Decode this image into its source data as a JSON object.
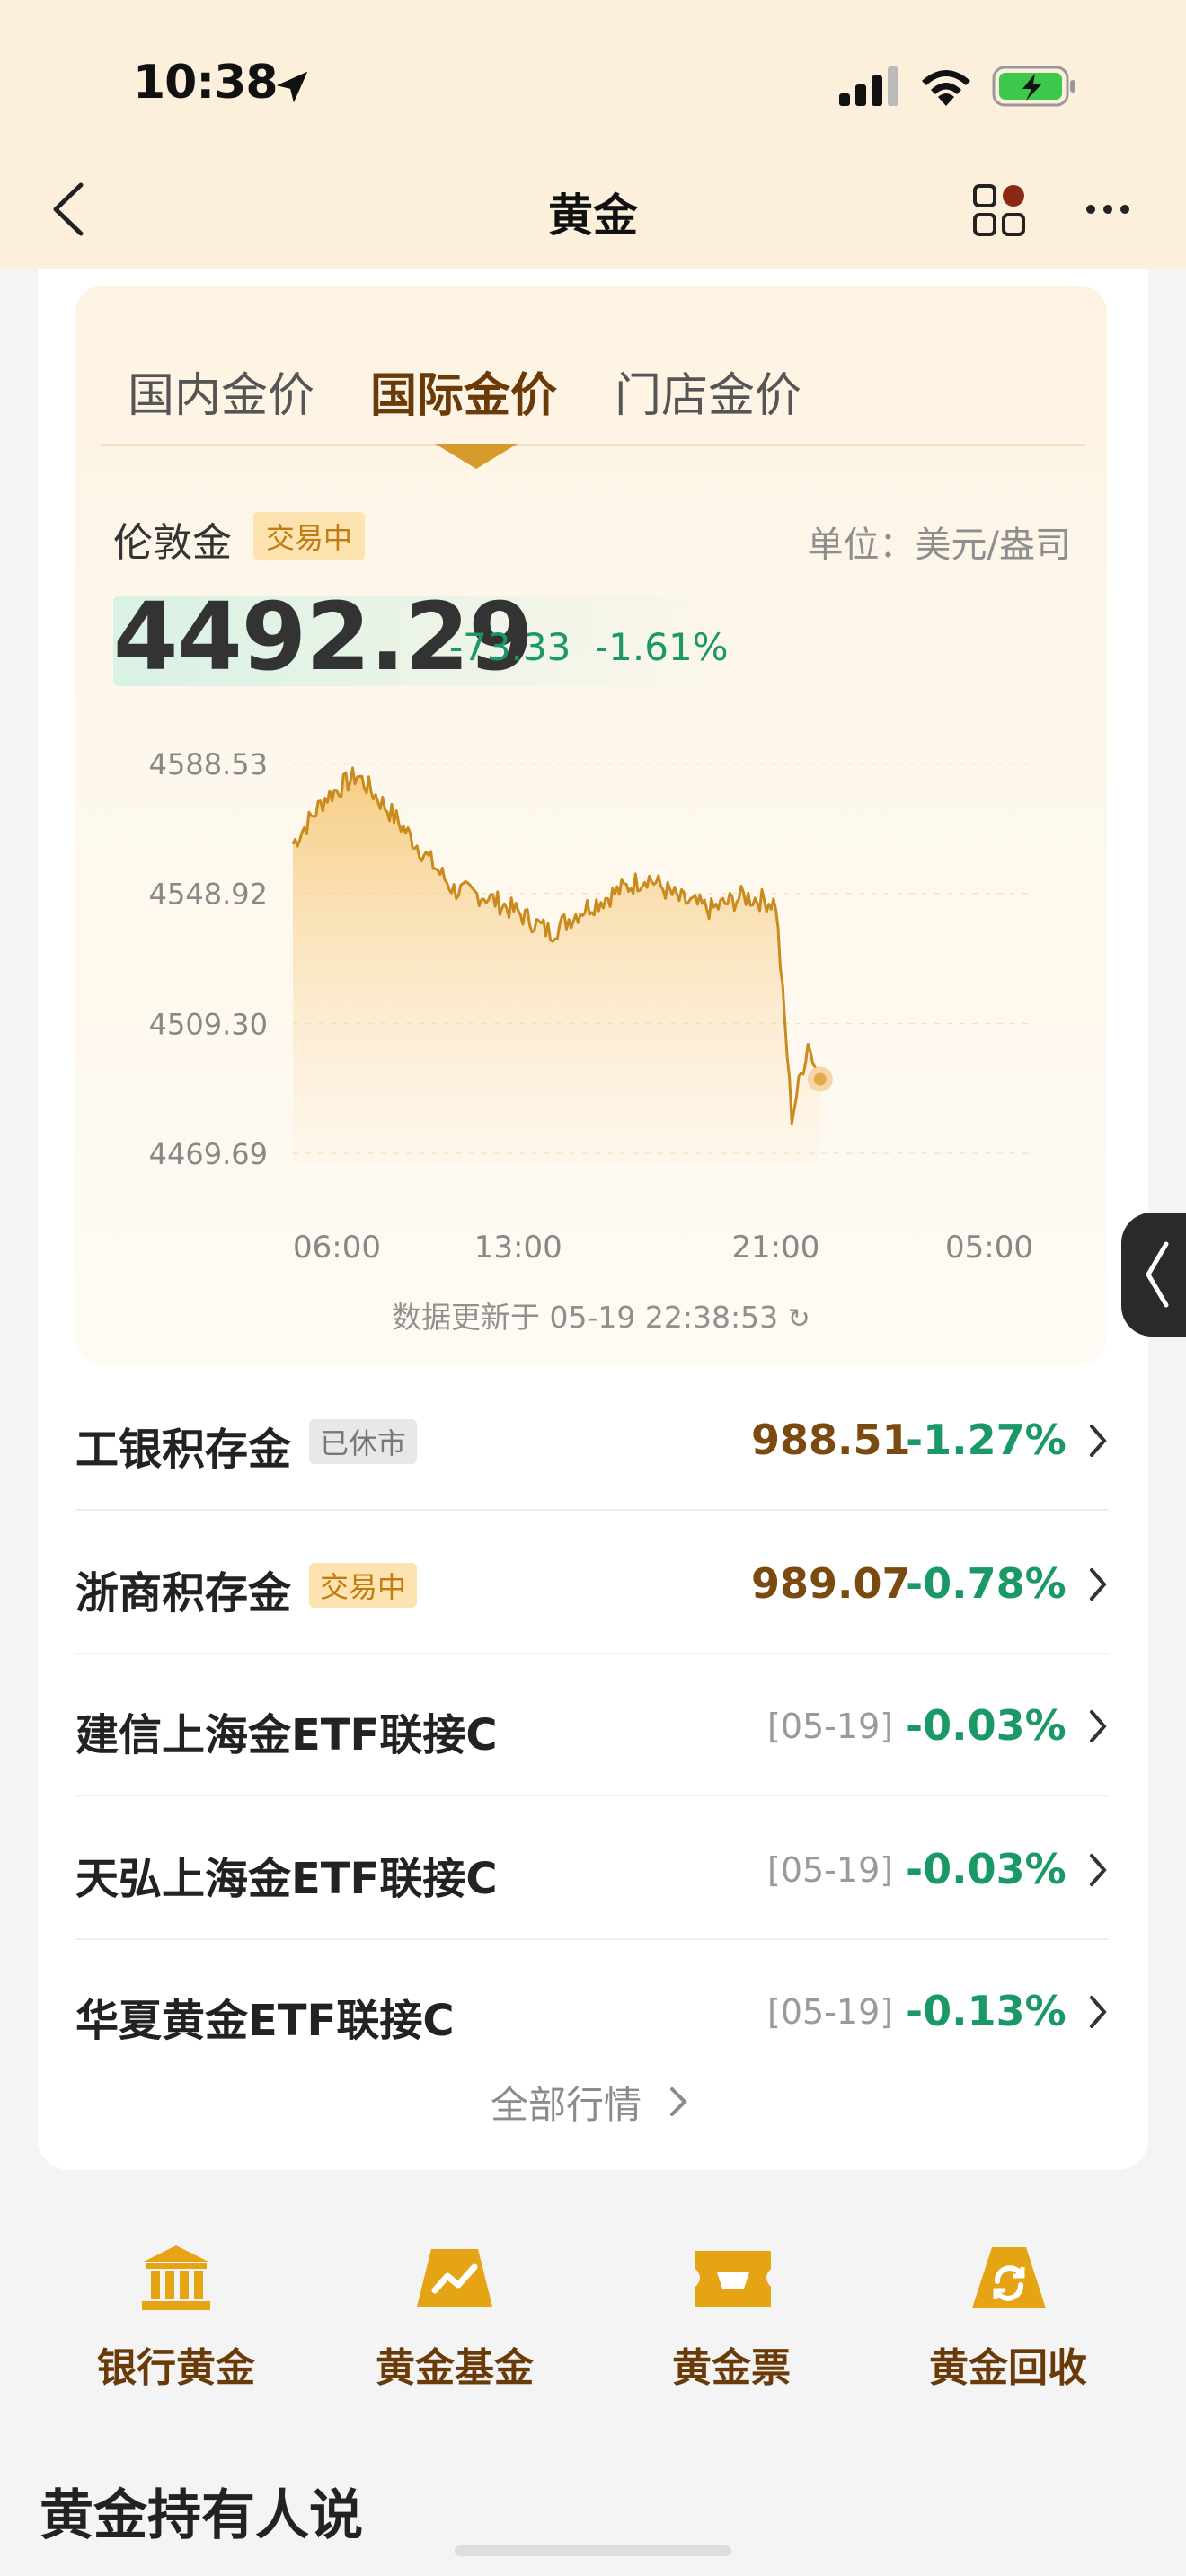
{
  "status_bar": {
    "time": "10:38"
  },
  "nav": {
    "title": "黄金"
  },
  "tabs": [
    {
      "label": "国内金价",
      "active": false
    },
    {
      "label": "国际金价",
      "active": true
    },
    {
      "label": "门店金价",
      "active": false
    }
  ],
  "quote": {
    "name": "伦敦金",
    "status": "交易中",
    "unit": "单位：美元/盎司",
    "price": "4492.29",
    "change": "-73.33",
    "change_pct": "-1.61%",
    "update_text": "数据更新于 05-19 22:38:53"
  },
  "chart_data": {
    "type": "area",
    "title": "",
    "y_ticks": [
      "4588.53",
      "4548.92",
      "4509.30",
      "4469.69"
    ],
    "x_ticks": [
      "06:00",
      "13:00",
      "21:00",
      "05:00"
    ],
    "ylim": [
      4469.69,
      4588.53
    ],
    "x_hours": [
      6,
      7,
      8,
      9,
      10,
      11,
      12,
      13,
      14,
      15,
      16,
      17,
      18,
      19,
      20,
      21,
      21.5,
      22,
      22.38
    ],
    "values": [
      4564,
      4578,
      4585,
      4574,
      4562,
      4550,
      4548,
      4543,
      4537,
      4544,
      4549,
      4554,
      4547,
      4544,
      4548,
      4546,
      4481,
      4503,
      4492.29
    ],
    "last_point": 4492.29,
    "color": "#d89b2b"
  },
  "products": [
    {
      "name": "工银积存金",
      "badge": "已休市",
      "badge_type": "closed",
      "date": "",
      "price": "988.51",
      "pct": "-1.27%"
    },
    {
      "name": "浙商积存金",
      "badge": "交易中",
      "badge_type": "open",
      "date": "",
      "price": "989.07",
      "pct": "-0.78%"
    },
    {
      "name": "建信上海金ETF联接C",
      "badge": "",
      "badge_type": "",
      "date": "[05-19]",
      "price": "",
      "pct": "-0.03%"
    },
    {
      "name": "天弘上海金ETF联接C",
      "badge": "",
      "badge_type": "",
      "date": "[05-19]",
      "price": "",
      "pct": "-0.03%"
    },
    {
      "name": "华夏黄金ETF联接C",
      "badge": "",
      "badge_type": "",
      "date": "[05-19]",
      "price": "",
      "pct": "-0.13%"
    }
  ],
  "all_market": "全部行情",
  "shortcuts": [
    {
      "label": "银行黄金",
      "icon": "bank-icon"
    },
    {
      "label": "黄金基金",
      "icon": "fund-chart-icon"
    },
    {
      "label": "黄金票",
      "icon": "ticket-icon"
    },
    {
      "label": "黄金回收",
      "icon": "recycle-icon"
    }
  ],
  "holders_title": "黄金持有人说",
  "colors": {
    "accent": "#d89b2b",
    "down": "#1a9866",
    "brown": "#6b3a09"
  }
}
